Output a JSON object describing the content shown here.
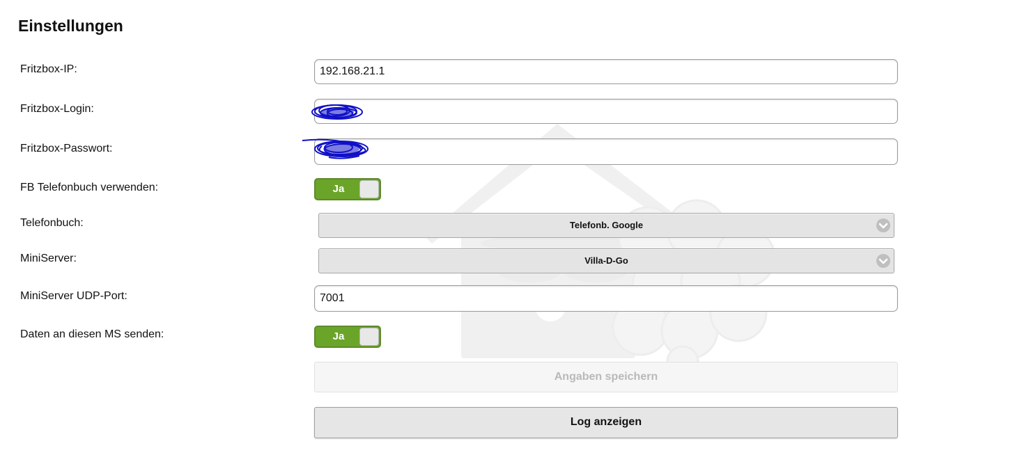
{
  "page": {
    "title": "Einstellungen"
  },
  "form": {
    "fritzbox_ip": {
      "label": "Fritzbox-IP:",
      "value": "192.168.21.1"
    },
    "fritzbox_login": {
      "label": "Fritzbox-Login:",
      "value": ""
    },
    "fritzbox_password": {
      "label": "Fritzbox-Passwort:",
      "value": ""
    },
    "fb_phonebook_toggle": {
      "label": "FB Telefonbuch verwenden:",
      "state": "Ja"
    },
    "phonebook": {
      "label": "Telefonbuch:",
      "selected": "Telefonb. Google"
    },
    "miniserver": {
      "label": "MiniServer:",
      "selected": "Villa-D-Go"
    },
    "miniserver_udp_port": {
      "label": "MiniServer UDP-Port:",
      "value": "7001"
    },
    "send_data_toggle": {
      "label": "Daten an diesen MS senden:",
      "state": "Ja"
    }
  },
  "buttons": {
    "save_label": "Angaben speichern",
    "log_label": "Log anzeigen"
  },
  "colors": {
    "toggle_on": "#6aa529",
    "redaction_scribble": "#1010c8"
  },
  "icons": {
    "select_arrow": "chevron-down-icon",
    "watermark": "house-raspberry-logo"
  }
}
